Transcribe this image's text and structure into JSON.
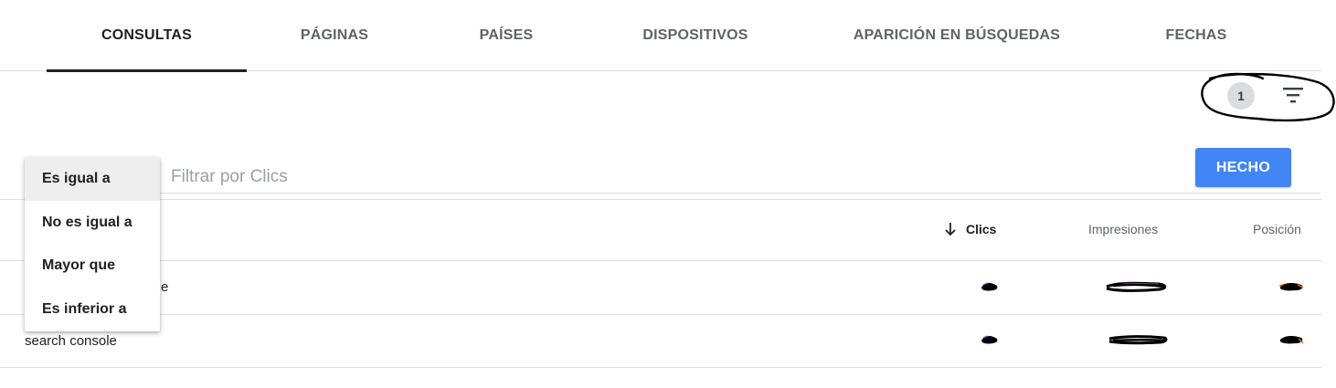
{
  "tabs": [
    {
      "label": "CONSULTAS",
      "active": true
    },
    {
      "label": "PÁGINAS",
      "active": false
    },
    {
      "label": "PAÍSES",
      "active": false
    },
    {
      "label": "DISPOSITIVOS",
      "active": false
    },
    {
      "label": "APARICIÓN EN BÚSQUEDAS",
      "active": false
    },
    {
      "label": "FECHAS",
      "active": false
    }
  ],
  "filters": {
    "active_count": "1",
    "icon": "filter-list-icon"
  },
  "filter_editor": {
    "placeholder": "Filtrar por Clics",
    "done_label": "HECHO",
    "done_color": "#4285f4"
  },
  "operator_menu": {
    "selected": "Es igual a",
    "items": [
      "Es igual a",
      "No es igual a",
      "Mayor que",
      "Es inferior a"
    ]
  },
  "table": {
    "sort_icon": "arrow-down-icon",
    "headers": {
      "clicks": "Clics",
      "impressions": "Impresiones",
      "position": "Posición"
    },
    "rows": [
      {
        "query_visible_suffix": "e",
        "values_redacted": true
      },
      {
        "query": "search console",
        "values_redacted": true
      }
    ]
  },
  "annotation": {
    "shape": "hand-drawn-circle-around-filter-controls",
    "color": "#000000"
  }
}
